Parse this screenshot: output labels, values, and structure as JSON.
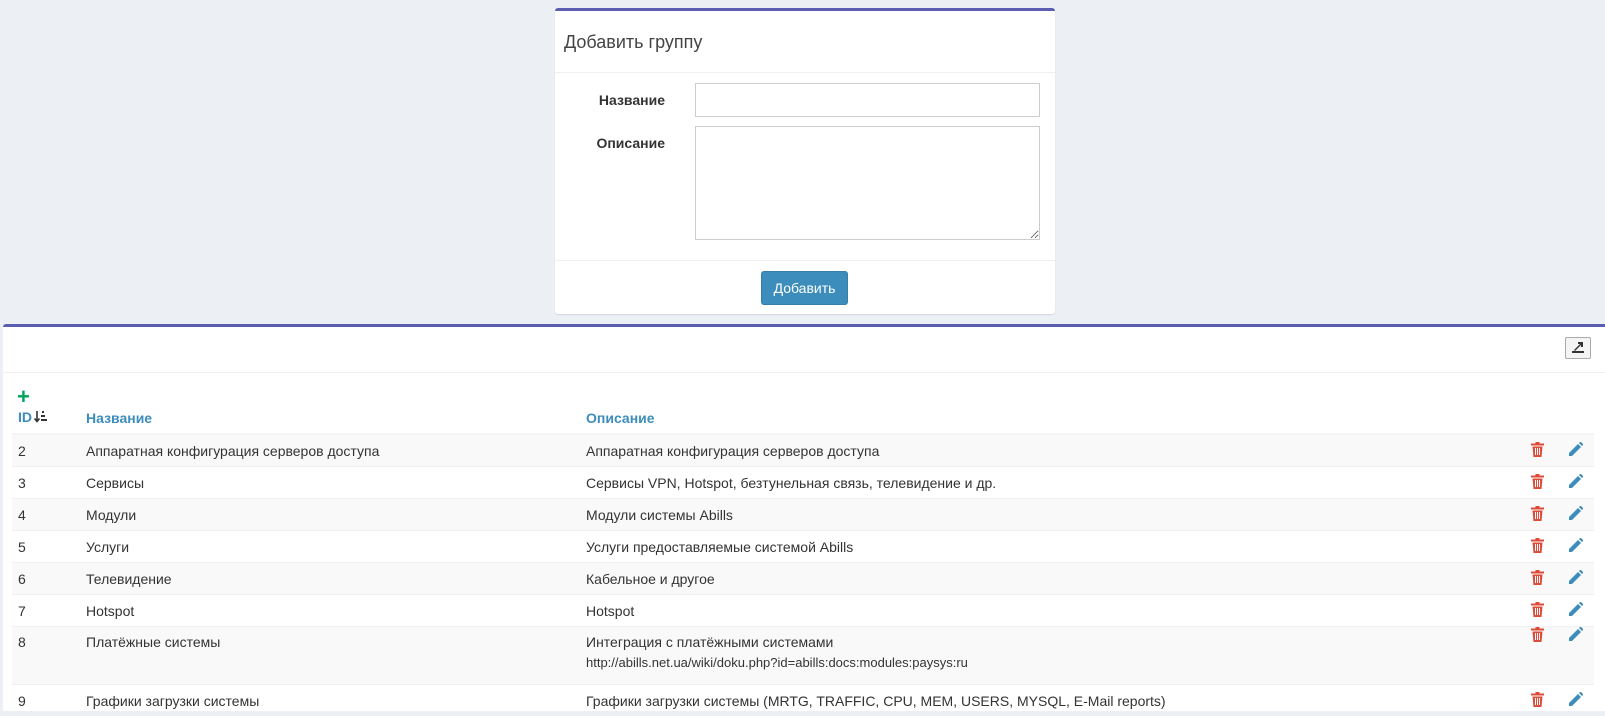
{
  "add_form": {
    "title": "Добавить группу",
    "name_label": "Название",
    "name_value": "",
    "description_label": "Описание",
    "description_value": "",
    "submit_label": "Добавить"
  },
  "list": {
    "columns": {
      "id": "ID",
      "name": "Название",
      "description": "Описание"
    },
    "sort_column": "ID",
    "rows": [
      {
        "id": "2",
        "name": "Аппаратная конфигурация серверов доступа",
        "description": "Аппаратная конфигурация серверов доступа",
        "description_extra": ""
      },
      {
        "id": "3",
        "name": "Сервисы",
        "description": "Сервисы VPN, Hotspot, безтунельная связь, телевидение и др.",
        "description_extra": ""
      },
      {
        "id": "4",
        "name": "Модули",
        "description": "Модули системы Abills",
        "description_extra": ""
      },
      {
        "id": "5",
        "name": "Услуги",
        "description": "Услуги предоставляемые системой Abills",
        "description_extra": ""
      },
      {
        "id": "6",
        "name": "Телевидение",
        "description": "Кабельное и другое",
        "description_extra": ""
      },
      {
        "id": "7",
        "name": "Hotspot",
        "description": "Hotspot",
        "description_extra": ""
      },
      {
        "id": "8",
        "name": "Платёжные системы",
        "description": "Интеграция с платёжными системами",
        "description_extra": "http://abills.net.ua/wiki/doku.php?id=abills:docs:modules:paysys:ru"
      },
      {
        "id": "9",
        "name": "Графики загрузки системы",
        "description": "Графики загрузки системы (MRTG, TRAFFIC, CPU, MEM, USERS, MYSQL, E-Mail reports)",
        "description_extra": ""
      }
    ]
  },
  "colors": {
    "accent": "#5a5db0",
    "primary": "#3c8dbc",
    "danger": "#dd4b39",
    "success": "#00a65a"
  },
  "icons": {
    "add": "plus-icon",
    "delete": "trash-icon",
    "edit": "pencil-icon",
    "export": "export-icon",
    "sort": "sort-numeric-desc-icon"
  }
}
